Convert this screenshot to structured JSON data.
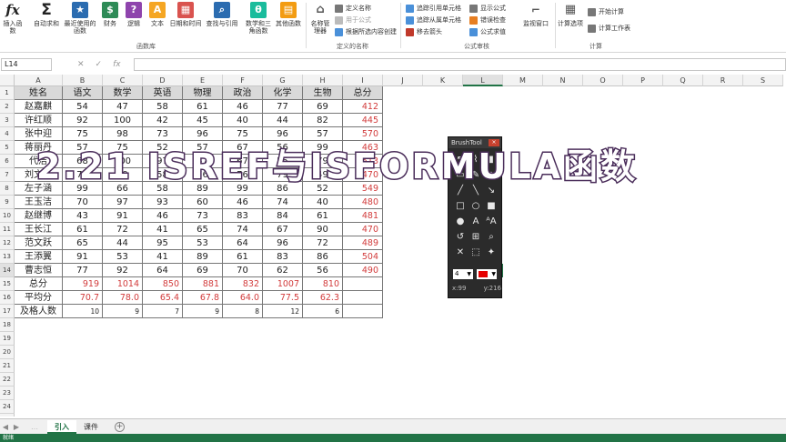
{
  "ribbon": {
    "buttons": [
      {
        "label": "插入函数",
        "icon": "fx-icon",
        "color": "#ffffff"
      },
      {
        "label": "自动求和",
        "icon": "sigma-icon",
        "color": "#ffffff"
      },
      {
        "label": "最近使用的函数",
        "icon": "star-icon",
        "color": "#2b6cb0"
      },
      {
        "label": "财务",
        "icon": "finance-icon",
        "color": "#2e8b57"
      },
      {
        "label": "逻辑",
        "icon": "question-icon",
        "color": "#8e44ad"
      },
      {
        "label": "文本",
        "icon": "text-icon",
        "color": "#f5a623"
      },
      {
        "label": "日期和时间",
        "icon": "calendar-icon",
        "color": "#d9534f"
      },
      {
        "label": "查找与引用",
        "icon": "lookup-icon",
        "color": "#2b6cb0"
      },
      {
        "label": "数学和三角函数",
        "icon": "math-icon",
        "color": "#1abc9c"
      },
      {
        "label": "其他函数",
        "icon": "more-functions-icon",
        "color": "#f39c12"
      }
    ],
    "function_library_label": "函数库",
    "name_manager_label": "名称管理器",
    "defined_names": {
      "define_name": "定义名称",
      "use_in_formula": "用于公式",
      "create_from_selection": "根据所选内容创建",
      "group_label": "定义的名称"
    },
    "formula_auditing": {
      "trace_precedents": "追踪引用单元格",
      "trace_dependents": "追踪从属单元格",
      "remove_arrows": "移去箭头",
      "show_formulas": "显示公式",
      "error_checking": "错误检查",
      "evaluate_formula": "公式求值",
      "watch_window": "监视窗口",
      "group_label": "公式审核"
    },
    "calculation": {
      "calc_options": "计算选项",
      "calc_now": "开始计算",
      "calc_sheet": "计算工作表",
      "group_label": "计算"
    }
  },
  "formula_bar": {
    "name_box": "L14",
    "cancel": "✕",
    "enter": "✓",
    "fx": "fx",
    "content": ""
  },
  "columns": [
    "A",
    "B",
    "C",
    "D",
    "E",
    "F",
    "G",
    "H",
    "I",
    "J",
    "K",
    "L",
    "M",
    "N",
    "O",
    "P",
    "Q",
    "R",
    "S"
  ],
  "rows": [
    "1",
    "2",
    "3",
    "4",
    "5",
    "6",
    "7",
    "8",
    "9",
    "10",
    "11",
    "12",
    "13",
    "14",
    "15",
    "16",
    "17",
    "18",
    "19",
    "20",
    "21",
    "22",
    "23",
    "24",
    "25"
  ],
  "table": {
    "headers": [
      "姓名",
      "语文",
      "数学",
      "英语",
      "物理",
      "政治",
      "化学",
      "生物",
      "总分"
    ],
    "rows": [
      [
        "赵嘉麒",
        "54",
        "47",
        "58",
        "61",
        "46",
        "77",
        "69",
        "412"
      ],
      [
        "许红顺",
        "92",
        "100",
        "42",
        "45",
        "40",
        "44",
        "82",
        "445"
      ],
      [
        "张中迎",
        "75",
        "98",
        "73",
        "96",
        "75",
        "96",
        "57",
        "570"
      ],
      [
        "蒋丽丹",
        "57",
        "75",
        "52",
        "57",
        "67",
        "56",
        "99",
        "463"
      ],
      [
        "代洁",
        "68",
        "100",
        "97",
        "47",
        "67",
        "55",
        "79",
        "513"
      ],
      [
        "刘文华",
        "73",
        "59",
        "58",
        "76",
        "76",
        "79",
        "49",
        "470"
      ],
      [
        "左子涵",
        "99",
        "66",
        "58",
        "89",
        "99",
        "86",
        "52",
        "549"
      ],
      [
        "王玉洁",
        "70",
        "97",
        "93",
        "60",
        "46",
        "74",
        "40",
        "480"
      ],
      [
        "赵继博",
        "43",
        "91",
        "46",
        "73",
        "83",
        "84",
        "61",
        "481"
      ],
      [
        "王长江",
        "61",
        "72",
        "41",
        "65",
        "74",
        "67",
        "90",
        "470"
      ],
      [
        "范文跃",
        "65",
        "44",
        "95",
        "53",
        "64",
        "96",
        "72",
        "489"
      ],
      [
        "王添翼",
        "91",
        "53",
        "41",
        "89",
        "61",
        "83",
        "86",
        "504"
      ],
      [
        "曹志恒",
        "77",
        "92",
        "64",
        "69",
        "70",
        "62",
        "56",
        "490"
      ]
    ],
    "summary": [
      {
        "label": "总分",
        "values": [
          "919",
          "1014",
          "850",
          "881",
          "832",
          "1007",
          "810"
        ]
      },
      {
        "label": "平均分",
        "values": [
          "70.7",
          "78.0",
          "65.4",
          "67.8",
          "64.0",
          "77.5",
          "62.3"
        ]
      },
      {
        "label": "及格人数",
        "values": [
          "10",
          "9",
          "7",
          "9",
          "8",
          "12",
          "6"
        ]
      }
    ]
  },
  "sheet_tabs": {
    "tabs": [
      "引入",
      "课件"
    ],
    "active": 0,
    "add": "+"
  },
  "status_bar": {
    "text": "就绪"
  },
  "brushtool": {
    "title": "BrushTool",
    "close": "×",
    "size_value": "4",
    "color": "#e60000",
    "coord_x": "x:99",
    "coord_y": "y:216",
    "tools": [
      "pointer-icon",
      "brush-icon",
      "highlighter-icon",
      "eraser-icon",
      "pen-icon",
      "fill-icon",
      "pencil-icon",
      "line-icon",
      "arrow-icon",
      "rectangle-icon",
      "ellipse-icon",
      "filled-rect-icon",
      "filled-ellipse-icon",
      "text-icon",
      "text-size-icon",
      "undo-icon",
      "grid-icon",
      "zoom-icon",
      "clear-icon",
      "select-icon",
      "pin-icon"
    ]
  },
  "overlay_title": "2.21 ISREF与ISFORMULA函数"
}
